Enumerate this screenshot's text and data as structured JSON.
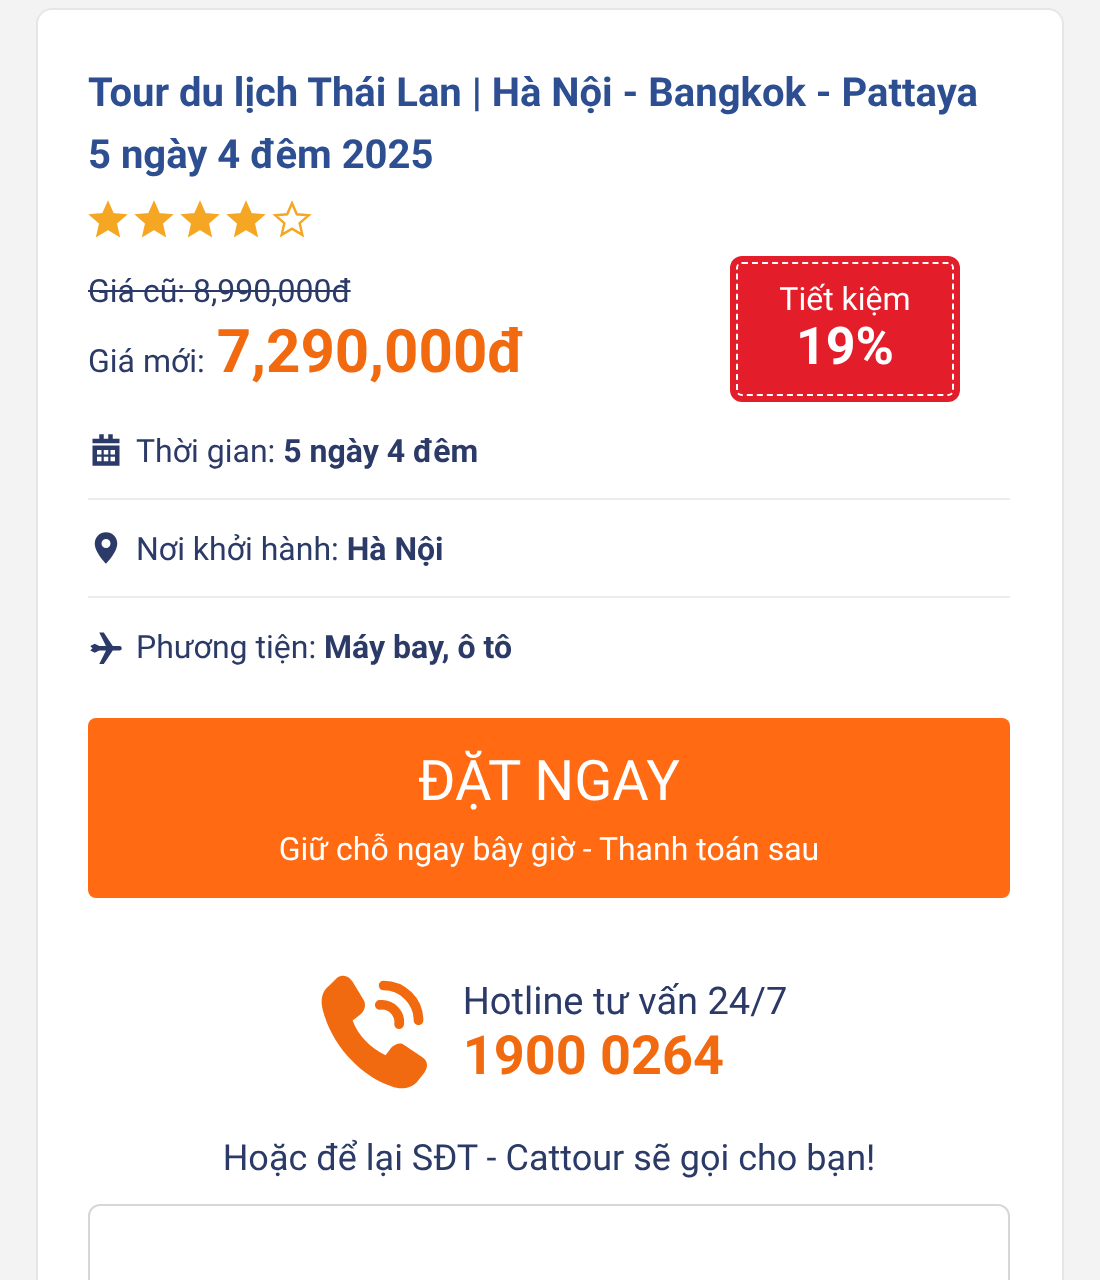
{
  "tour": {
    "title": "Tour du lịch Thái Lan | Hà Nội - Bangkok - Pattaya 5 ngày 4 đêm 2025",
    "stars": 4,
    "old_price": "Giá cũ: 8,990,000đ",
    "new_price_label": "Giá mới:",
    "new_price": "7,290,000đ",
    "discount": {
      "label": "Tiết kiệm",
      "value": "19%"
    },
    "details": [
      {
        "kind": "calendar",
        "label": "Thời gian:",
        "value": "5 ngày 4 đêm"
      },
      {
        "kind": "pin",
        "label": "Nơi khởi hành:",
        "value": "Hà Nội"
      },
      {
        "kind": "plane",
        "label": "Phương tiện:",
        "value": "Máy bay, ô tô"
      }
    ],
    "book_button": {
      "title": "ĐẶT NGAY",
      "subtitle": "Giữ chỗ ngay bây giờ - Thanh toán sau"
    },
    "hotline": {
      "label": "Hotline tư vấn 24/7",
      "number": "1900 0264"
    },
    "callback_text": "Hoặc để lại SĐT - Cattour sẽ gọi cho bạn!"
  }
}
